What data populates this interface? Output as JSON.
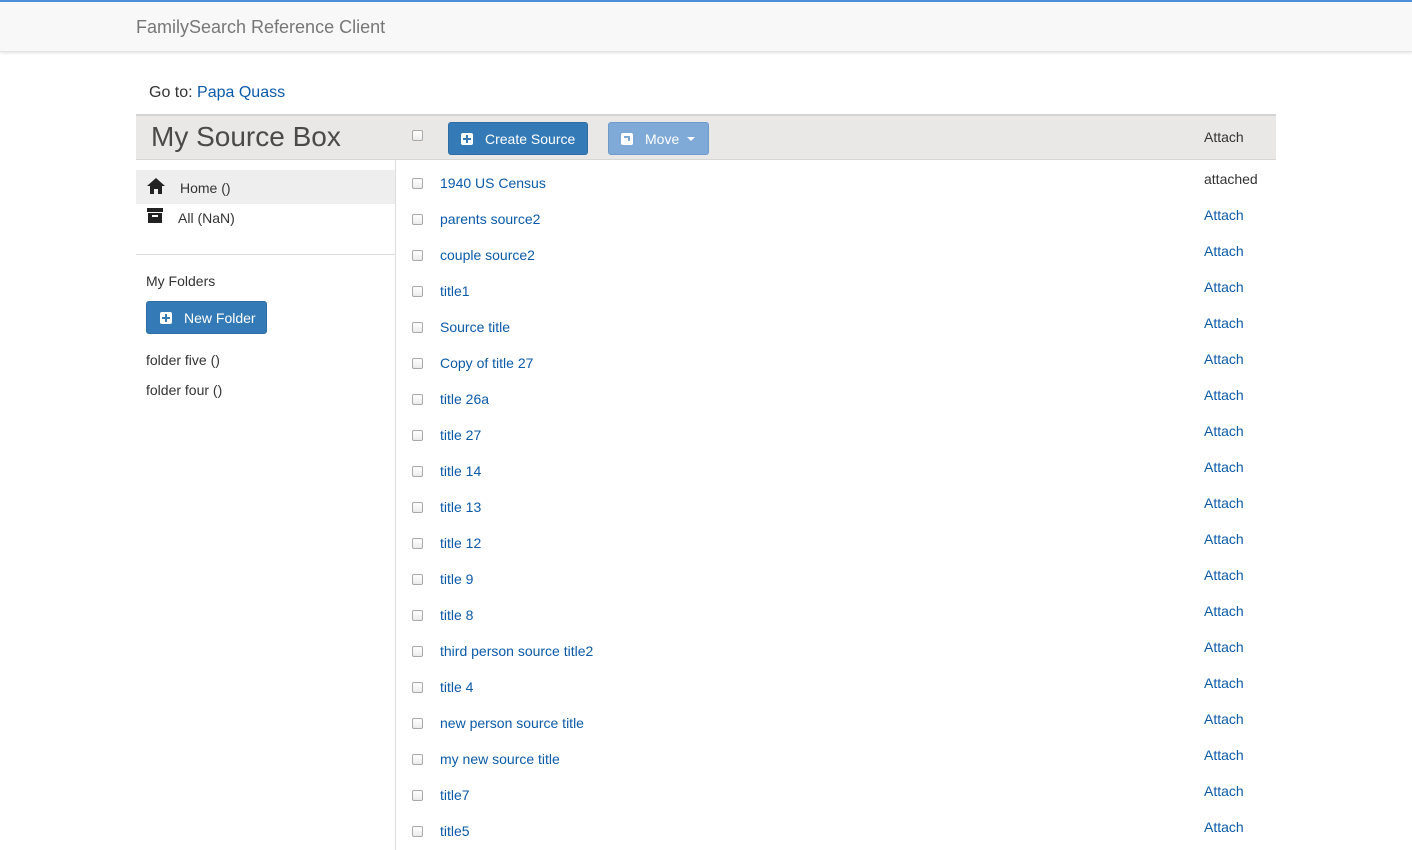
{
  "navbar": {
    "brand": "FamilySearch Reference Client"
  },
  "goto": {
    "label": "Go to:",
    "person": "Papa Quass"
  },
  "header": {
    "title": "My Source Box",
    "create_label": "Create Source",
    "move_label": "Move",
    "attach_label": "Attach"
  },
  "sidebar": {
    "home": "Home ()",
    "all": "All (NaN)",
    "folders_label": "My Folders",
    "new_folder_label": "New Folder",
    "folders": [
      "folder five ()",
      "folder four ()"
    ]
  },
  "sources": [
    {
      "title": "1940 US Census",
      "action": "attached"
    },
    {
      "title": "parents source2",
      "action": "Attach"
    },
    {
      "title": "couple source2",
      "action": "Attach"
    },
    {
      "title": "title1",
      "action": "Attach"
    },
    {
      "title": "Source title",
      "action": "Attach"
    },
    {
      "title": "Copy of title 27",
      "action": "Attach"
    },
    {
      "title": "title 26a",
      "action": "Attach"
    },
    {
      "title": "title 27",
      "action": "Attach"
    },
    {
      "title": "title 14",
      "action": "Attach"
    },
    {
      "title": "title 13",
      "action": "Attach"
    },
    {
      "title": "title 12",
      "action": "Attach"
    },
    {
      "title": "title 9",
      "action": "Attach"
    },
    {
      "title": "title 8",
      "action": "Attach"
    },
    {
      "title": "third person source title2",
      "action": "Attach"
    },
    {
      "title": "title 4",
      "action": "Attach"
    },
    {
      "title": "new person source title",
      "action": "Attach"
    },
    {
      "title": "my new source title",
      "action": "Attach"
    },
    {
      "title": "title7",
      "action": "Attach"
    },
    {
      "title": "title5",
      "action": "Attach"
    }
  ],
  "colors": {
    "primary": "#337ab7",
    "link": "#0b5aa8",
    "navbar_accent": "#4a90d9"
  },
  "icons": {
    "home": "home-icon",
    "all": "archive-icon",
    "create": "plus-square-icon",
    "move": "share-icon"
  }
}
